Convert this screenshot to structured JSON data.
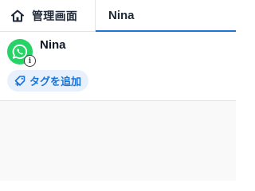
{
  "tabs": {
    "home": {
      "label": "管理画面",
      "icon": "home-icon"
    },
    "active": {
      "label": "Nina"
    }
  },
  "contact": {
    "name": "Nina",
    "avatar_icon": "whatsapp-icon",
    "badge_icon": "info-icon",
    "badge_text": "i"
  },
  "tag_button": {
    "label": "タグを追加",
    "icon": "tag-add-icon"
  },
  "colors": {
    "accent": "#1976d2",
    "whatsapp": "#25d366",
    "tag_bg": "#e8f1fb",
    "tag_text": "#1a73d9"
  }
}
